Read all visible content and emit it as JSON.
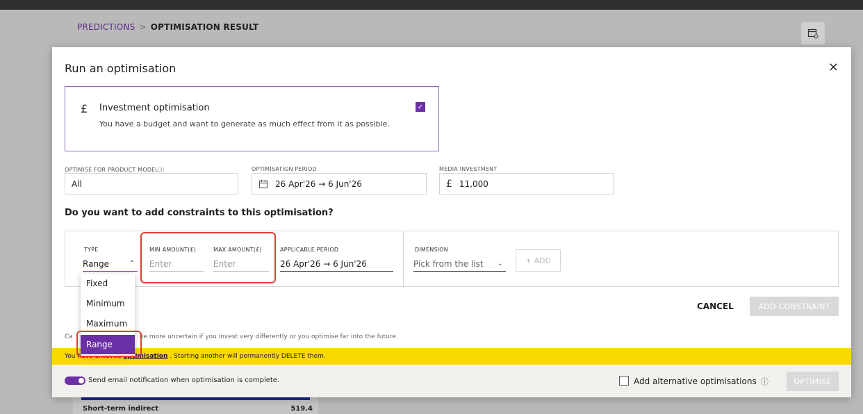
{
  "breadcrumb": {
    "parent": "PREDICTIONS",
    "separator": ">",
    "current": "OPTIMISATION RESULT"
  },
  "background": {
    "row_label": "Short-term indirect",
    "row_value": "519.4"
  },
  "modal": {
    "title": "Run an optimisation",
    "close": "×",
    "option_card": {
      "currency_symbol": "£",
      "title": "Investment optimisation",
      "description": "You have a budget and want to generate as much effect from it as possible.",
      "checked": true
    },
    "fields": {
      "product_model_label": "OPTIMISE FOR PRODUCT MODEL",
      "product_model_value": "All",
      "period_label": "OPTIMISATION PERIOD",
      "period_value": "26 Apr'26 → 6 Jun'26",
      "investment_label": "MEDIA INVESTMENT",
      "investment_currency": "£",
      "investment_value": "11,000"
    },
    "constraints_question": "Do you want to add constraints to this optimisation?",
    "constraint": {
      "type_label": "TYPE",
      "type_value": "Range",
      "min_label": "MIN AMOUNT(£)",
      "min_placeholder": "Enter",
      "max_label": "MAX AMOUNT(£)",
      "max_placeholder": "Enter",
      "period_label": "APPLICABLE PERIOD",
      "period_value": "26 Apr'26 → 6 Jun'26",
      "dimension_label": "DIMENSION",
      "dimension_placeholder": "Pick from the list",
      "add_label": "+ ADD"
    },
    "type_options": [
      "Fixed",
      "Minimum",
      "Maximum",
      "Range"
    ],
    "selected_type": "Range",
    "cancel_label": "CANCEL",
    "add_constraint_label": "ADD CONSTRAINT",
    "note_prefix": "Ca",
    "note_text": "be more uncertain if you invest very differently or you optimise far into the future.",
    "warning": {
      "prefix": "You have unsaved",
      "link": "optimisation",
      "suffix": ". Starting another will permanently DELETE them."
    },
    "footer": {
      "email_text": "Send email notification when optimisation is complete.",
      "alt_text": "Add alternative optimisations",
      "optimise_label": "OPTIMISE"
    }
  },
  "colors": {
    "accent": "#6b2fa6",
    "warning": "#fad900",
    "highlight": "#d9442e"
  }
}
